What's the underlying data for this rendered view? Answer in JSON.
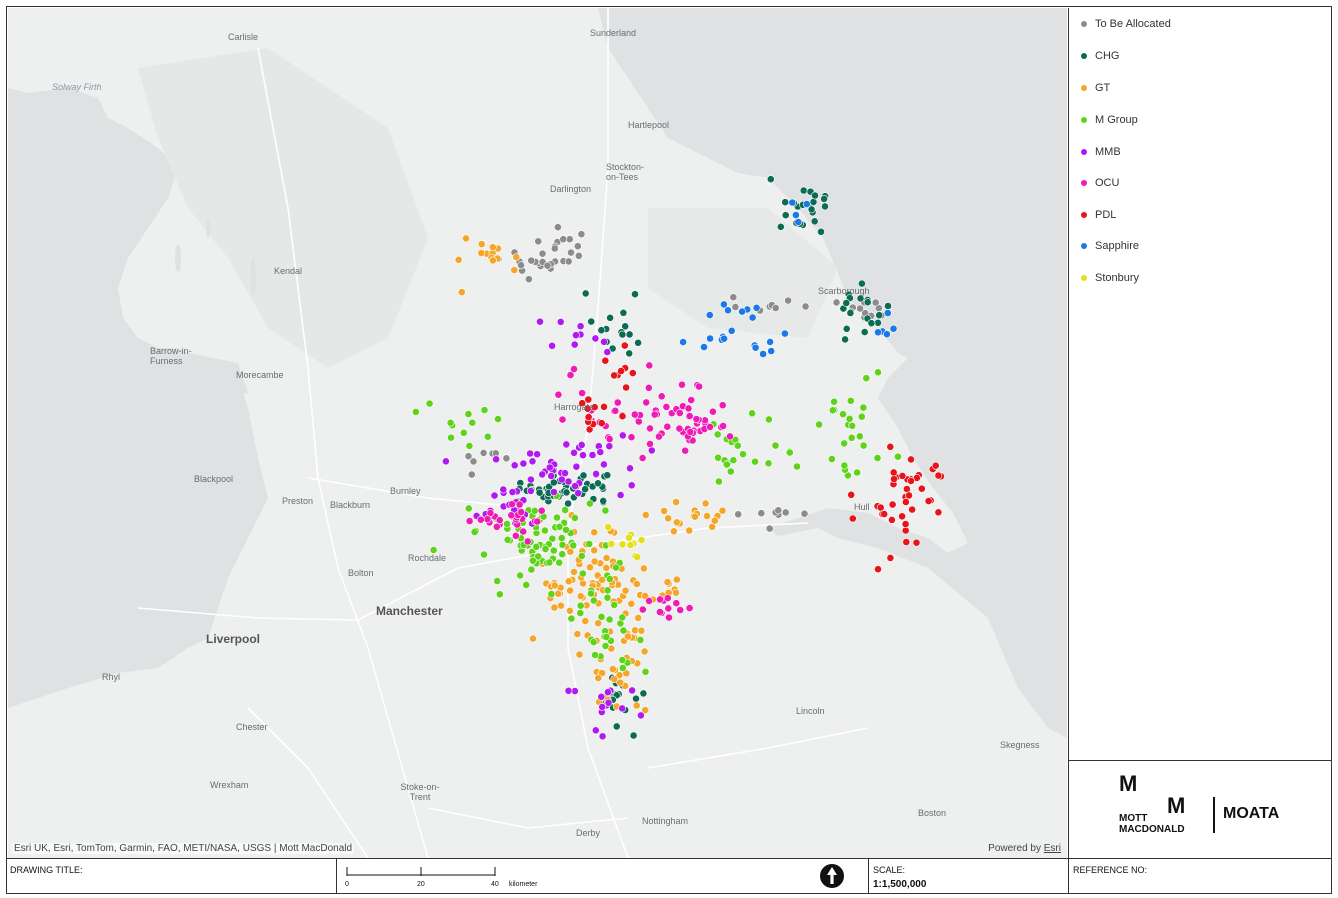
{
  "map": {
    "attribution": "Esri UK, Esri, TomTom, Garmin, FAO, METI/NASA, USGS | Mott MacDonald",
    "powered_by": "Powered by",
    "powered_link": "Esri",
    "places": {
      "solway_firth": "Solway Firth",
      "carlisle": "Carlisle",
      "sunderland": "Sunderland",
      "hartlepool": "Hartlepool",
      "stockton": "Stockton-on-Tees",
      "darlington": "Darlington",
      "kendal": "Kendal",
      "barrow": "Barrow-in-Furness",
      "morecambe": "Morecambe",
      "blackpool": "Blackpool",
      "preston": "Preston",
      "blackburn": "Blackburn",
      "burnley": "Burnley",
      "rochdale": "Rochdale",
      "bolton": "Bolton",
      "manchester": "Manchester",
      "liverpool": "Liverpool",
      "rhyl": "Rhyl",
      "chester": "Chester",
      "wrexham": "Wrexham",
      "stoke": "Stoke-on-Trent",
      "derby": "Derby",
      "nottingham": "Nottingham",
      "lincoln": "Lincoln",
      "boston": "Boston",
      "skegness": "Skegness",
      "hull": "Hull",
      "scarborough": "Scarborough",
      "harrogate": "Harrogate"
    }
  },
  "legend": {
    "items": [
      {
        "label": "To Be Allocated",
        "color": "#8c8c8c"
      },
      {
        "label": "CHG",
        "color": "#0b6b53"
      },
      {
        "label": "GT",
        "color": "#f4a62a"
      },
      {
        "label": "M Group",
        "color": "#5fd31a"
      },
      {
        "label": "MMB",
        "color": "#b01aef"
      },
      {
        "label": "OCU",
        "color": "#ee1bb4"
      },
      {
        "label": "PDL",
        "color": "#e8141b"
      },
      {
        "label": "Sapphire",
        "color": "#1a78e8"
      },
      {
        "label": "Stonbury",
        "color": "#e3e01a"
      }
    ]
  },
  "logo": {
    "mark": "M",
    "name_line1": "MOTT",
    "name_line2": "MACDONALD",
    "product": "MOATA"
  },
  "footer": {
    "drawing_title_label": "DRAWING TITLE:",
    "scale_label": "SCALE:",
    "scale_value": "1:1,500,000",
    "reference_label": "REFERENCE NO:",
    "scalebar_ticks": [
      "0",
      "20",
      "40"
    ],
    "scalebar_unit": "kilometer",
    "north_icon": "north-arrow-icon"
  }
}
